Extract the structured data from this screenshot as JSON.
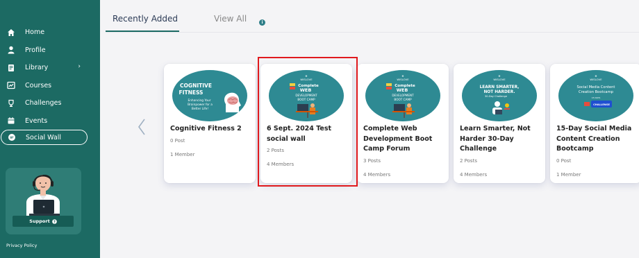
{
  "sidebar": {
    "items": [
      {
        "label": "Home",
        "icon": "home-icon"
      },
      {
        "label": "Profile",
        "icon": "user-icon"
      },
      {
        "label": "Library",
        "icon": "book-icon",
        "has_submenu": true
      },
      {
        "label": "Courses",
        "icon": "courses-icon"
      },
      {
        "label": "Challenges",
        "icon": "trophy-icon"
      },
      {
        "label": "Events",
        "icon": "calendar-icon"
      },
      {
        "label": "Social Wall",
        "icon": "chat-icon",
        "active": true
      }
    ],
    "support_label": "Support",
    "privacy_label": "Privacy Policy"
  },
  "tabs": {
    "recently_added": "Recently Added",
    "view_all": "View All"
  },
  "cards": [
    {
      "title": "Cognitive Fitness 2",
      "posts": "0 Post",
      "members": "1 Member",
      "image": {
        "heading": "COGNITIVE FITNESS",
        "subtext": "Enhancing Your Brainpower for a Better Life!"
      }
    },
    {
      "title": "6 Sept. 2024 Test social wall",
      "posts": "2 Posts",
      "members": "4 Members",
      "image": {
        "brand": "WISLOVE",
        "line1": "Complete",
        "line2": "WEB",
        "line3": "DEVELOPMENT",
        "line4": "BOOT CAMP"
      }
    },
    {
      "title": "Complete Web Development Boot Camp Forum",
      "posts": "3 Posts",
      "members": "4 Members",
      "image": {
        "brand": "WISLOVE",
        "line1": "Complete",
        "line2": "WEB",
        "line3": "DEVELOPMENT",
        "line4": "BOOT CAMP"
      }
    },
    {
      "title": "Learn Smarter, Not Harder 30-Day Challenge",
      "posts": "2 Posts",
      "members": "4 Members",
      "image": {
        "brand": "WISLOVE",
        "heading": "LEARN SMARTER, NOT HARDER.",
        "subtext": "30-Day Challenge"
      }
    },
    {
      "title": "15-Day Social Media Content Creation Bootcamp",
      "posts": "0 Post",
      "members": "1 Member",
      "image": {
        "brand": "WISLOVE",
        "heading": "Social Media Content Creation Bootcamp",
        "badge": "CHALLENGE"
      }
    }
  ],
  "colors": {
    "sidebar": "#1c6a63",
    "accent": "#2e7e88",
    "highlight": "#e0191d"
  }
}
